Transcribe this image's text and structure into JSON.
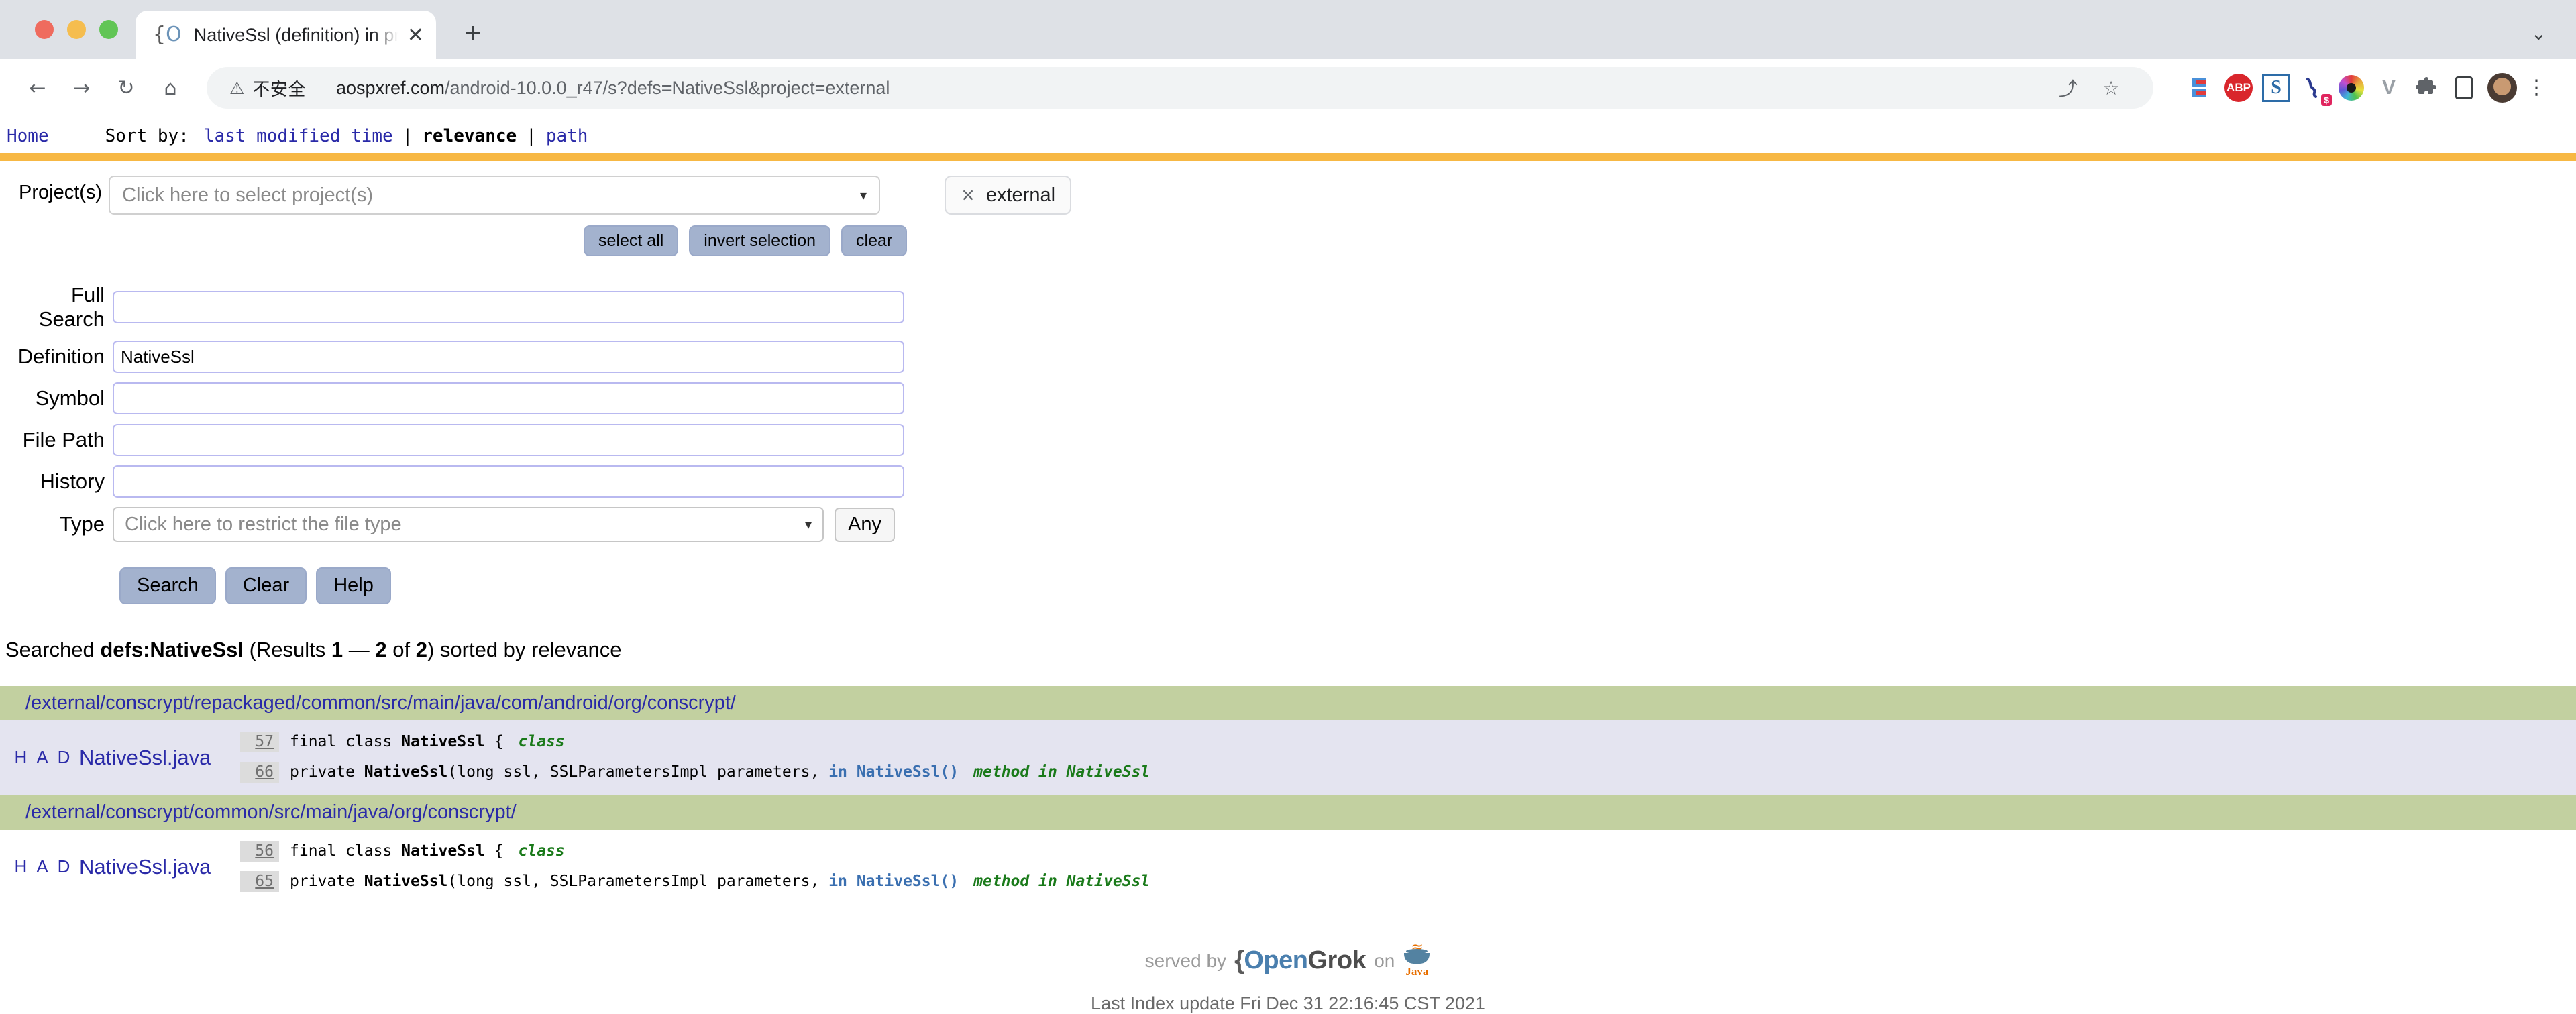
{
  "browser": {
    "window_controls": [
      "close",
      "minimize",
      "maximize"
    ],
    "tab": {
      "favicon_brace": "{",
      "favicon_o": "O",
      "title": "NativeSsl (definition) in project",
      "close_label": "✕"
    },
    "new_tab_label": "+",
    "tab_list_chevron": "⌄",
    "nav": {
      "back": "←",
      "forward": "→",
      "reload": "↻",
      "home": "⌂"
    },
    "omnibox": {
      "warning_icon": "⚠",
      "security_text": "不安全",
      "url_host": "aospxref.com",
      "url_path": "/android-10.0.0_r47/s?defs=NativeSsl&project=external",
      "share_icon": "⤴",
      "bookmark_icon": "☆"
    },
    "extensions": [
      {
        "name": "bookmark-manager-icon",
        "label": ""
      },
      {
        "name": "adblock-plus-icon",
        "label": "ABP"
      },
      {
        "name": "sanskrit-s-icon",
        "label": "S"
      },
      {
        "name": "honey-icon",
        "label": "$"
      },
      {
        "name": "color-ring-icon",
        "label": ""
      },
      {
        "name": "vimium-icon",
        "label": "V"
      },
      {
        "name": "puzzle-extensions-icon",
        "label": "⧉"
      },
      {
        "name": "side-panel-icon",
        "label": ""
      }
    ],
    "profile_avatar": "user-avatar",
    "menu_dots": "⋮"
  },
  "topnav": {
    "home": "Home",
    "sort_label": "Sort by:",
    "sort_options": [
      {
        "label": "last modified time",
        "active": false
      },
      {
        "label": "relevance",
        "active": true
      },
      {
        "label": "path",
        "active": false
      }
    ],
    "separator": "|"
  },
  "search_form": {
    "project_label": "Project(s)",
    "project_placeholder": "Click here to select project(s)",
    "project_caret": "▾",
    "selected_project_chip": {
      "remove": "×",
      "label": "external"
    },
    "project_buttons": [
      "select all",
      "invert selection",
      "clear"
    ],
    "fields": [
      {
        "label": "Full Search",
        "value": "",
        "name": "full-search-input"
      },
      {
        "label": "Definition",
        "value": "NativeSsl",
        "name": "definition-input"
      },
      {
        "label": "Symbol",
        "value": "",
        "name": "symbol-input"
      },
      {
        "label": "File Path",
        "value": "",
        "name": "file-path-input"
      },
      {
        "label": "History",
        "value": "",
        "name": "history-input"
      }
    ],
    "type_label": "Type",
    "type_placeholder": "Click here to restrict the file type",
    "type_caret": "▾",
    "any_button": "Any",
    "action_buttons": [
      "Search",
      "Clear",
      "Help"
    ]
  },
  "results_summary": {
    "prefix": "Searched ",
    "query": "defs:NativeSsl",
    "open_paren": " (Results ",
    "range_from": "1",
    "dash": " — ",
    "range_to": "2",
    "of": " of ",
    "total": "2",
    "suffix": ") sorted by relevance"
  },
  "results": [
    {
      "directory": "/external/conscrypt/repackaged/common/src/main/java/com/android/org/conscrypt/",
      "row_style": "alt",
      "flags": [
        "H",
        "A",
        "D"
      ],
      "filename": "NativeSsl.java",
      "lines": [
        {
          "number": "57",
          "code_pre": "final class ",
          "code_bold": "NativeSsl",
          "code_post": " {",
          "tag_class": "class",
          "tag_in": "",
          "tag_method": ""
        },
        {
          "number": "66",
          "code_pre": "private ",
          "code_bold": "NativeSsl",
          "code_post": "(long ssl, SSLParametersImpl parameters,",
          "tag_class": "",
          "tag_in": "in NativeSsl()",
          "tag_method": "method in NativeSsl"
        }
      ]
    },
    {
      "directory": "/external/conscrypt/common/src/main/java/org/conscrypt/",
      "row_style": "plain",
      "flags": [
        "H",
        "A",
        "D"
      ],
      "filename": "NativeSsl.java",
      "lines": [
        {
          "number": "56",
          "code_pre": "final class ",
          "code_bold": "NativeSsl",
          "code_post": " {",
          "tag_class": "class",
          "tag_in": "",
          "tag_method": ""
        },
        {
          "number": "65",
          "code_pre": "private ",
          "code_bold": "NativeSsl",
          "code_post": "(long ssl, SSLParametersImpl parameters,",
          "tag_class": "",
          "tag_in": "in NativeSsl()",
          "tag_method": "method in NativeSsl"
        }
      ]
    }
  ],
  "footer": {
    "served_by": "served by",
    "opengrok_brace": "{",
    "opengrok_open": "Open",
    "opengrok_grok": "Grok",
    "on": "on",
    "java_word": "Java",
    "java_steam": "≈",
    "last_index": "Last Index update Fri Dec 31 22:16:45 CST 2021"
  },
  "colors": {
    "accent_orange": "#f7b844",
    "dir_green": "#c2d0a0",
    "row_alt": "#e4e4f0",
    "link_blue": "#2a2aa8",
    "button_blue": "#a3b2ce",
    "tag_green": "#1a7a1a",
    "tag_blue": "#3a6fb0"
  }
}
